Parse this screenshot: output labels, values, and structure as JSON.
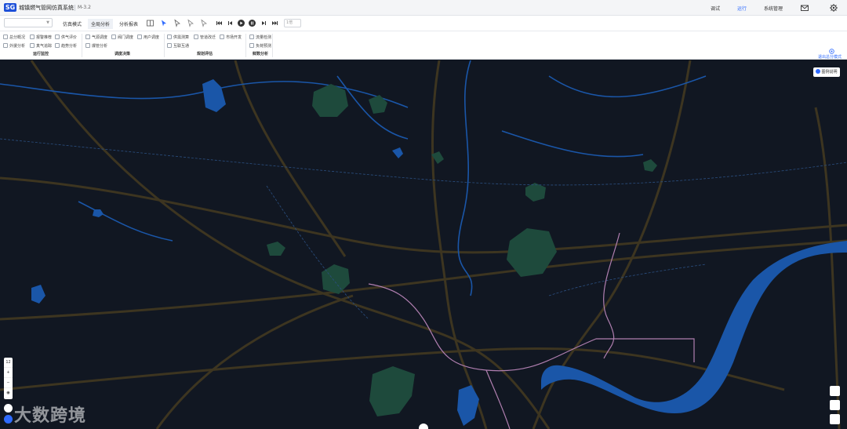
{
  "header": {
    "logo_text": "SG",
    "app_title": "城镇燃气管网仿真系统",
    "version": "M-3.2",
    "menu": [
      {
        "label": "调试",
        "active": false
      },
      {
        "label": "运行",
        "active": true
      },
      {
        "label": "系统管理",
        "active": false
      }
    ],
    "icons": [
      "mail-icon",
      "gear-icon"
    ]
  },
  "toolbar": {
    "scenario_select_value": "",
    "tabs": [
      {
        "label": "仿真模式",
        "active": false
      },
      {
        "label": "全局分析",
        "active": true
      },
      {
        "label": "分析报表",
        "active": false
      }
    ],
    "speed_value": "1倍"
  },
  "ribbon": {
    "groups": [
      {
        "label": "运行监控",
        "items": [
          "总分概况",
          "报警推荐",
          "供气评价",
          "外援分析",
          "真气追踪",
          "趋势分析"
        ]
      },
      {
        "label": "调度决策",
        "items": [
          "气源调度",
          "阀门调度",
          "用户调度",
          "爆管分析"
        ]
      },
      {
        "label": "规划评估",
        "items": [
          "供需测算",
          "管道改迁",
          "市场开发",
          "互联互通"
        ]
      },
      {
        "label": "鲜数分析",
        "items": [
          "流量检测",
          "负荷预测"
        ]
      }
    ],
    "exit_label": "退出总分模式"
  },
  "map": {
    "legend_label": "图例说明",
    "zoom_level": "12",
    "watermark": "大数跨境",
    "colors": {
      "background": "#111722",
      "water": "#1a56a8",
      "park": "#1e4a3c",
      "road": "#3d3520",
      "pipeline": "#b07fb0"
    }
  }
}
